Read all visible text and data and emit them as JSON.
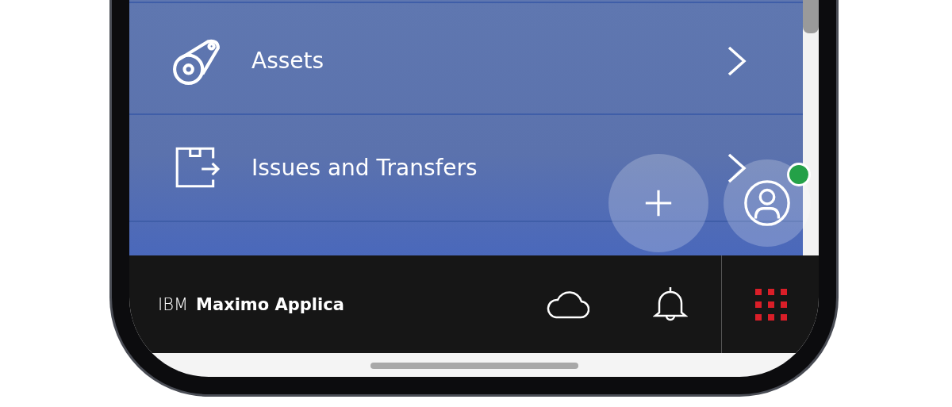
{
  "menu": {
    "items": [
      {
        "label": "Assets",
        "kind": "asset"
      },
      {
        "label": "Issues and Transfers",
        "kind": "transfer"
      }
    ]
  },
  "profile": {
    "online": true
  },
  "footer": {
    "brand": "IBM",
    "product": "Maximo Applica"
  }
}
